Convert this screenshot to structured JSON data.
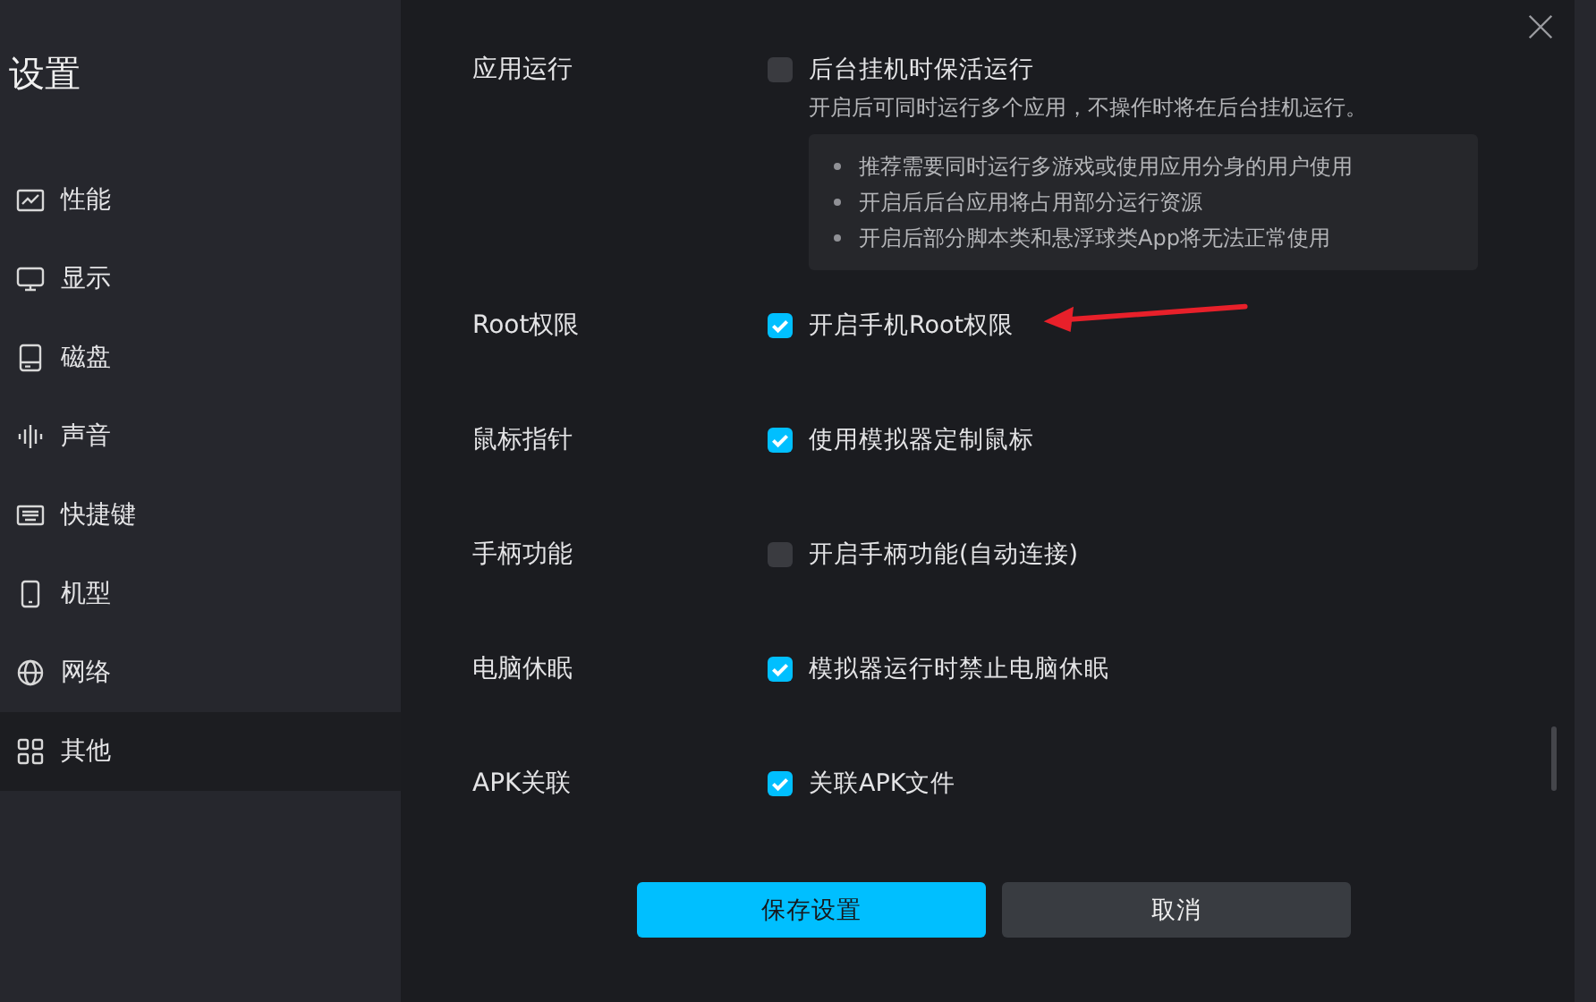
{
  "sidebar": {
    "title": "设置",
    "items": [
      {
        "label": "性能",
        "selected": false
      },
      {
        "label": "显示",
        "selected": false
      },
      {
        "label": "磁盘",
        "selected": false
      },
      {
        "label": "声音",
        "selected": false
      },
      {
        "label": "快捷键",
        "selected": false
      },
      {
        "label": "机型",
        "selected": false
      },
      {
        "label": "网络",
        "selected": false
      },
      {
        "label": "其他",
        "selected": true
      }
    ]
  },
  "settings": [
    {
      "label": "应用运行",
      "option": "后台挂机时保活运行",
      "checked": false,
      "description": "开启后可同时运行多个应用，不操作时将在后台挂机运行。",
      "notes": [
        "推荐需要同时运行多游戏或使用应用分身的用户使用",
        "开启后后台应用将占用部分运行资源",
        "开启后部分脚本类和悬浮球类App将无法正常使用"
      ]
    },
    {
      "label": "Root权限",
      "option": "开启手机Root权限",
      "checked": true,
      "arrow": true
    },
    {
      "label": "鼠标指针",
      "option": "使用模拟器定制鼠标",
      "checked": true
    },
    {
      "label": "手柄功能",
      "option": "开启手柄功能(自动连接)",
      "checked": false
    },
    {
      "label": "电脑休眠",
      "option": "模拟器运行时禁止电脑休眠",
      "checked": true
    },
    {
      "label": "APK关联",
      "option": "关联APK文件",
      "checked": true
    }
  ],
  "buttons": [
    {
      "label": "保存设置",
      "kind": "primary"
    },
    {
      "label": "取消",
      "kind": "secondary"
    }
  ]
}
